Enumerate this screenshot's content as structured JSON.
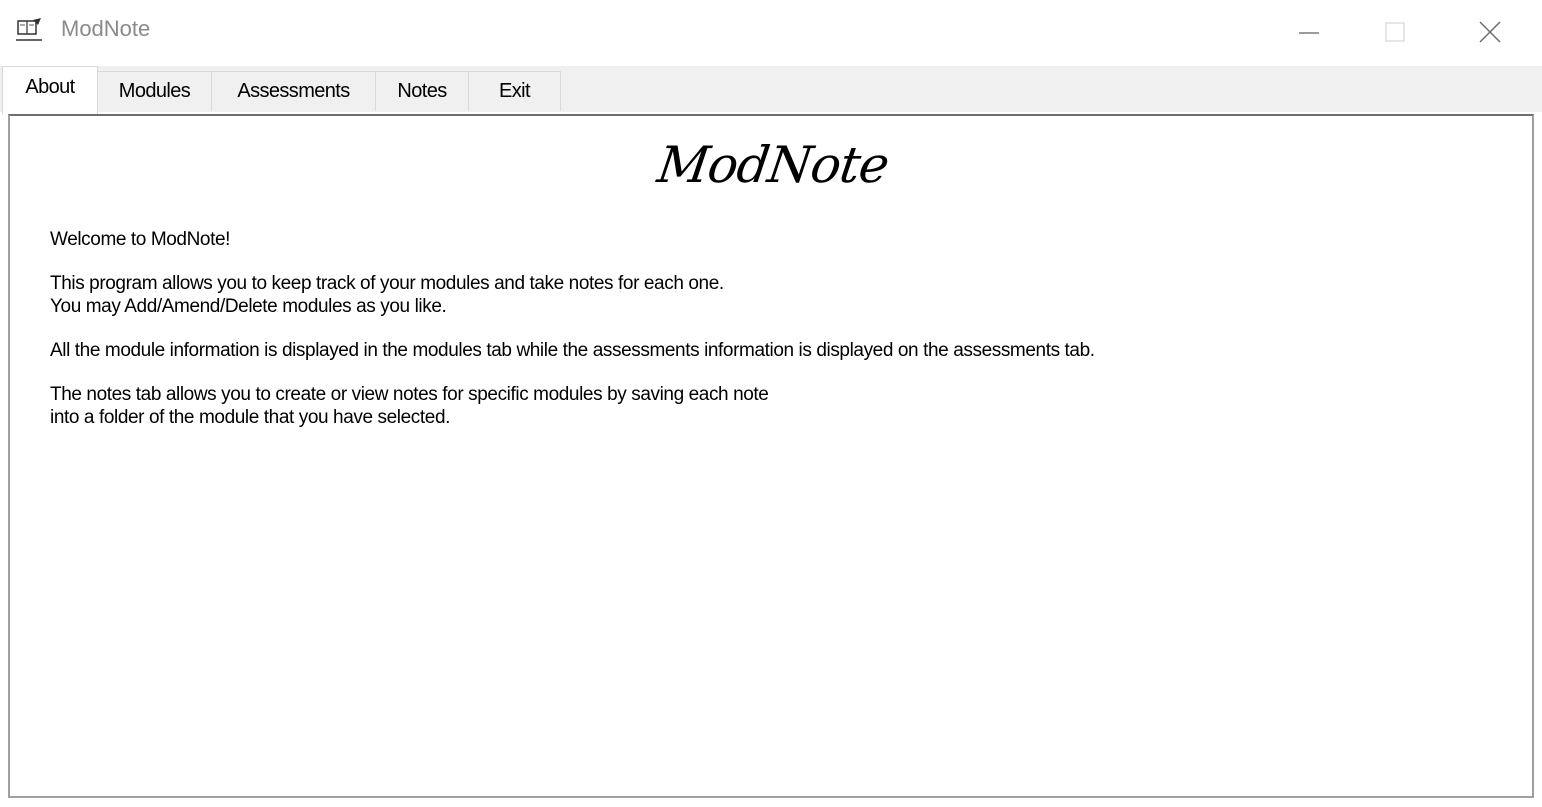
{
  "window": {
    "title": "ModNote",
    "icon": "notebook-icon"
  },
  "tabs": [
    {
      "label": "About",
      "active": true
    },
    {
      "label": "Modules",
      "active": false
    },
    {
      "label": "Assessments",
      "active": false
    },
    {
      "label": "Notes",
      "active": false
    },
    {
      "label": "Exit",
      "active": false
    }
  ],
  "about": {
    "logo": "ModNote",
    "paragraphs": [
      [
        "Welcome to ModNote!"
      ],
      [
        "This program allows you to keep track of your modules and take notes for each one.",
        "You may Add/Amend/Delete modules as you like."
      ],
      [
        "All the module information is displayed in the modules tab while the assessments information is displayed on the assessments tab."
      ],
      [
        "The notes tab allows you to create or view notes for specific modules by saving each note",
        "into a folder of the module that you have selected."
      ]
    ]
  }
}
